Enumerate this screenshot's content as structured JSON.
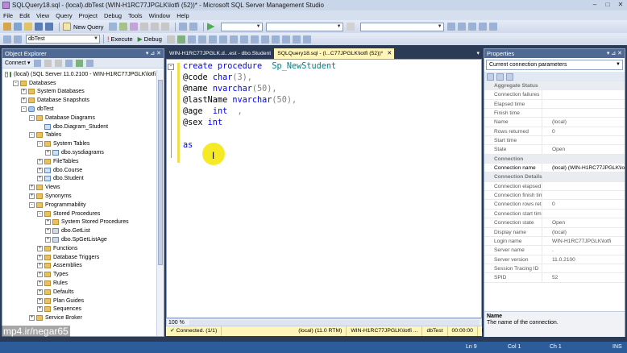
{
  "window": {
    "title": "SQLQuery18.sql - (local).dbTest (WIN-H1RC77JPGLK\\lotfi (52))* - Microsoft SQL Server Management Studio",
    "controls": [
      "–",
      "□",
      "✕"
    ]
  },
  "menu": [
    "File",
    "Edit",
    "View",
    "Query",
    "Project",
    "Debug",
    "Tools",
    "Window",
    "Help"
  ],
  "toolbar": {
    "new_query_label": "New Query",
    "database_value": "dbTest",
    "execute_label": "Execute",
    "debug_label": "Debug"
  },
  "object_explorer": {
    "title": "Object Explorer",
    "connect_label": "Connect ▾",
    "tree": [
      {
        "label": "(local) (SQL Server 11.0.2100 - WIN-H1RC77JPGLK\\lotfi)",
        "level": 0,
        "exp": "-",
        "icon": "server-icon"
      },
      {
        "label": "Databases",
        "level": 1,
        "exp": "-",
        "icon": "folder-icon"
      },
      {
        "label": "System Databases",
        "level": 2,
        "exp": "+",
        "icon": "folder-icon"
      },
      {
        "label": "Database Snapshots",
        "level": 2,
        "exp": "+",
        "icon": "folder-icon"
      },
      {
        "label": "dbTest",
        "level": 2,
        "exp": "-",
        "icon": "database-icon"
      },
      {
        "label": "Database Diagrams",
        "level": 3,
        "exp": "-",
        "icon": "folder-icon"
      },
      {
        "label": "dbo.Diagram_Student",
        "level": 4,
        "exp": "",
        "icon": "diagram-icon"
      },
      {
        "label": "Tables",
        "level": 3,
        "exp": "-",
        "icon": "folder-icon"
      },
      {
        "label": "System Tables",
        "level": 4,
        "exp": "-",
        "icon": "folder-icon"
      },
      {
        "label": "dbo.sysdiagrams",
        "level": 5,
        "exp": "+",
        "icon": "table-icon"
      },
      {
        "label": "FileTables",
        "level": 4,
        "exp": "+",
        "icon": "folder-icon"
      },
      {
        "label": "dbo.Course",
        "level": 4,
        "exp": "+",
        "icon": "table-icon"
      },
      {
        "label": "dbo.Student",
        "level": 4,
        "exp": "+",
        "icon": "table-icon"
      },
      {
        "label": "Views",
        "level": 3,
        "exp": "+",
        "icon": "folder-icon"
      },
      {
        "label": "Synonyms",
        "level": 3,
        "exp": "+",
        "icon": "folder-icon"
      },
      {
        "label": "Programmability",
        "level": 3,
        "exp": "-",
        "icon": "folder-icon"
      },
      {
        "label": "Stored Procedures",
        "level": 4,
        "exp": "-",
        "icon": "folder-icon"
      },
      {
        "label": "System Stored Procedures",
        "level": 5,
        "exp": "+",
        "icon": "folder-icon"
      },
      {
        "label": "dbo.GetList",
        "level": 5,
        "exp": "+",
        "icon": "procedure-icon"
      },
      {
        "label": "dbo.SpGetListAge",
        "level": 5,
        "exp": "+",
        "icon": "procedure-icon"
      },
      {
        "label": "Functions",
        "level": 4,
        "exp": "+",
        "icon": "folder-icon"
      },
      {
        "label": "Database Triggers",
        "level": 4,
        "exp": "+",
        "icon": "folder-icon"
      },
      {
        "label": "Assemblies",
        "level": 4,
        "exp": "+",
        "icon": "folder-icon"
      },
      {
        "label": "Types",
        "level": 4,
        "exp": "+",
        "icon": "folder-icon"
      },
      {
        "label": "Rules",
        "level": 4,
        "exp": "+",
        "icon": "folder-icon"
      },
      {
        "label": "Defaults",
        "level": 4,
        "exp": "+",
        "icon": "folder-icon"
      },
      {
        "label": "Plan Guides",
        "level": 4,
        "exp": "+",
        "icon": "folder-icon"
      },
      {
        "label": "Sequences",
        "level": 4,
        "exp": "+",
        "icon": "folder-icon"
      },
      {
        "label": "Service Broker",
        "level": 3,
        "exp": "+",
        "icon": "folder-icon"
      }
    ]
  },
  "editor": {
    "tabs": [
      {
        "label": "WIN-H1RC77JPGLK.d...est - dbo.Student",
        "active": false
      },
      {
        "label": "SQLQuery18.sql - (l...C77JPGLK\\lotfi (52))*",
        "active": true
      }
    ],
    "code_lines": [
      [
        {
          "t": "create procedure",
          "c": "kw"
        },
        {
          "t": "  ",
          "c": "pl"
        },
        {
          "t": "Sp_NewStudent",
          "c": "str"
        }
      ],
      [
        {
          "t": "@code ",
          "c": "var"
        },
        {
          "t": "char",
          "c": "kw"
        },
        {
          "t": "(3),",
          "c": "gr"
        }
      ],
      [
        {
          "t": "@name ",
          "c": "var"
        },
        {
          "t": "nvarchar",
          "c": "kw"
        },
        {
          "t": "(50),",
          "c": "gr"
        }
      ],
      [
        {
          "t": "@lastName ",
          "c": "var"
        },
        {
          "t": "nvarchar",
          "c": "kw"
        },
        {
          "t": "(50),",
          "c": "gr"
        }
      ],
      [
        {
          "t": "@age  ",
          "c": "var"
        },
        {
          "t": "int",
          "c": "kw"
        },
        {
          "t": "  ,",
          "c": "gr"
        }
      ],
      [
        {
          "t": "@sex ",
          "c": "var"
        },
        {
          "t": "int",
          "c": "kw"
        }
      ],
      [
        {
          "t": "",
          "c": "pl"
        }
      ],
      [
        {
          "t": "as",
          "c": "kw"
        }
      ]
    ],
    "zoom": "100 %"
  },
  "query_status": {
    "connected": "Connected. (1/1)",
    "server": "(local) (11.0 RTM)",
    "user": "WIN-H1RC77JPGLK\\lotfi ...",
    "database": "dbTest",
    "elapsed": "00:00:00",
    "rows": "0 rows"
  },
  "properties": {
    "title": "Properties",
    "selected": "Current connection parameters",
    "rows": [
      {
        "k": "Aggregate Status",
        "cat": true
      },
      {
        "k": "Connection failures",
        "v": ""
      },
      {
        "k": "Elapsed time",
        "v": ""
      },
      {
        "k": "Finish time",
        "v": ""
      },
      {
        "k": "Name",
        "v": "(local)"
      },
      {
        "k": "Rows returned",
        "v": "0"
      },
      {
        "k": "Start time",
        "v": ""
      },
      {
        "k": "State",
        "v": "Open"
      },
      {
        "k": "Connection",
        "cat": true
      },
      {
        "k": "Connection name",
        "v": "(local) (WIN-H1RC77JPGLK\\lotfi",
        "hl": true
      },
      {
        "k": "Connection Details",
        "cat": true
      },
      {
        "k": "Connection elapsed tir",
        "v": ""
      },
      {
        "k": "Connection finish time",
        "v": ""
      },
      {
        "k": "Connection rows returi",
        "v": "0"
      },
      {
        "k": "Connection start time",
        "v": ""
      },
      {
        "k": "Connection state",
        "v": "Open"
      },
      {
        "k": "Display name",
        "v": "(local)"
      },
      {
        "k": "Login name",
        "v": "WIN-H1RC77JPGLK\\lotfi"
      },
      {
        "k": "Server name",
        "v": "."
      },
      {
        "k": "Server version",
        "v": "11.0.2100"
      },
      {
        "k": "Session Tracing ID",
        "v": ""
      },
      {
        "k": "SPID",
        "v": "52"
      }
    ],
    "desc_title": "Name",
    "desc_text": "The name of the connection."
  },
  "status_bar": {
    "ln": "Ln 9",
    "col": "Col 1",
    "ch": "Ch 1",
    "ins": "INS"
  },
  "watermark": "mp4.ir/negar65",
  "colors": {
    "keyword": "#0000ff",
    "identifier": "#008080",
    "punct": "#808080",
    "accent": "#2c5d9a"
  }
}
